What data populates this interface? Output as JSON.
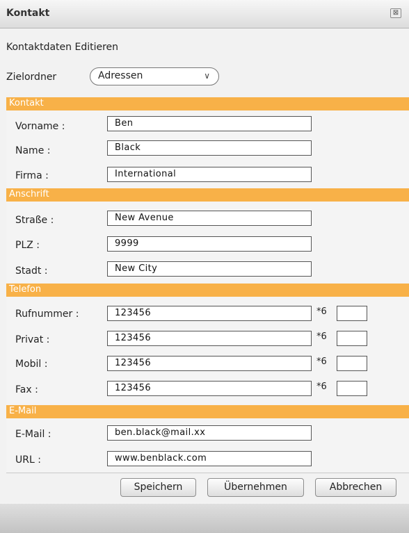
{
  "window": {
    "title": "Kontakt",
    "close_glyph": "⊠"
  },
  "heading": "Kontaktdaten Editieren",
  "folder": {
    "label": "Zielordner",
    "value": "Adressen",
    "chevron": "∨"
  },
  "sections": {
    "kontakt": "Kontakt",
    "anschrift": "Anschrift",
    "telefon": "Telefon",
    "email": "E-Mail"
  },
  "kontakt": {
    "vorname": {
      "label": "Vorname :",
      "value": "Ben"
    },
    "name": {
      "label": "Name :",
      "value": "Black"
    },
    "firma": {
      "label": "Firma :",
      "value": "International"
    }
  },
  "anschrift": {
    "strasse": {
      "label": "Straße :",
      "value": "New Avenue"
    },
    "plz": {
      "label": "PLZ :",
      "value": "9999"
    },
    "stadt": {
      "label": "Stadt :",
      "value": "New City"
    }
  },
  "telefon": {
    "rufnummer": {
      "label": "Rufnummer :",
      "value": "123456",
      "ext_label": "*6",
      "ext_value": ""
    },
    "privat": {
      "label": "Privat :",
      "value": "123456",
      "ext_label": "*6",
      "ext_value": ""
    },
    "mobil": {
      "label": "Mobil :",
      "value": "123456",
      "ext_label": "*6",
      "ext_value": ""
    },
    "fax": {
      "label": "Fax :",
      "value": "123456",
      "ext_label": "*6",
      "ext_value": ""
    }
  },
  "email": {
    "email": {
      "label": "E-Mail :",
      "value": "ben.black@mail.xx"
    },
    "url": {
      "label": "URL :",
      "value": "www.benblack.com"
    }
  },
  "buttons": {
    "save": "Speichern",
    "apply": "Übernehmen",
    "cancel": "Abbrechen"
  },
  "colors": {
    "section_header": "#f8b148",
    "background": "#f2f2f2"
  }
}
